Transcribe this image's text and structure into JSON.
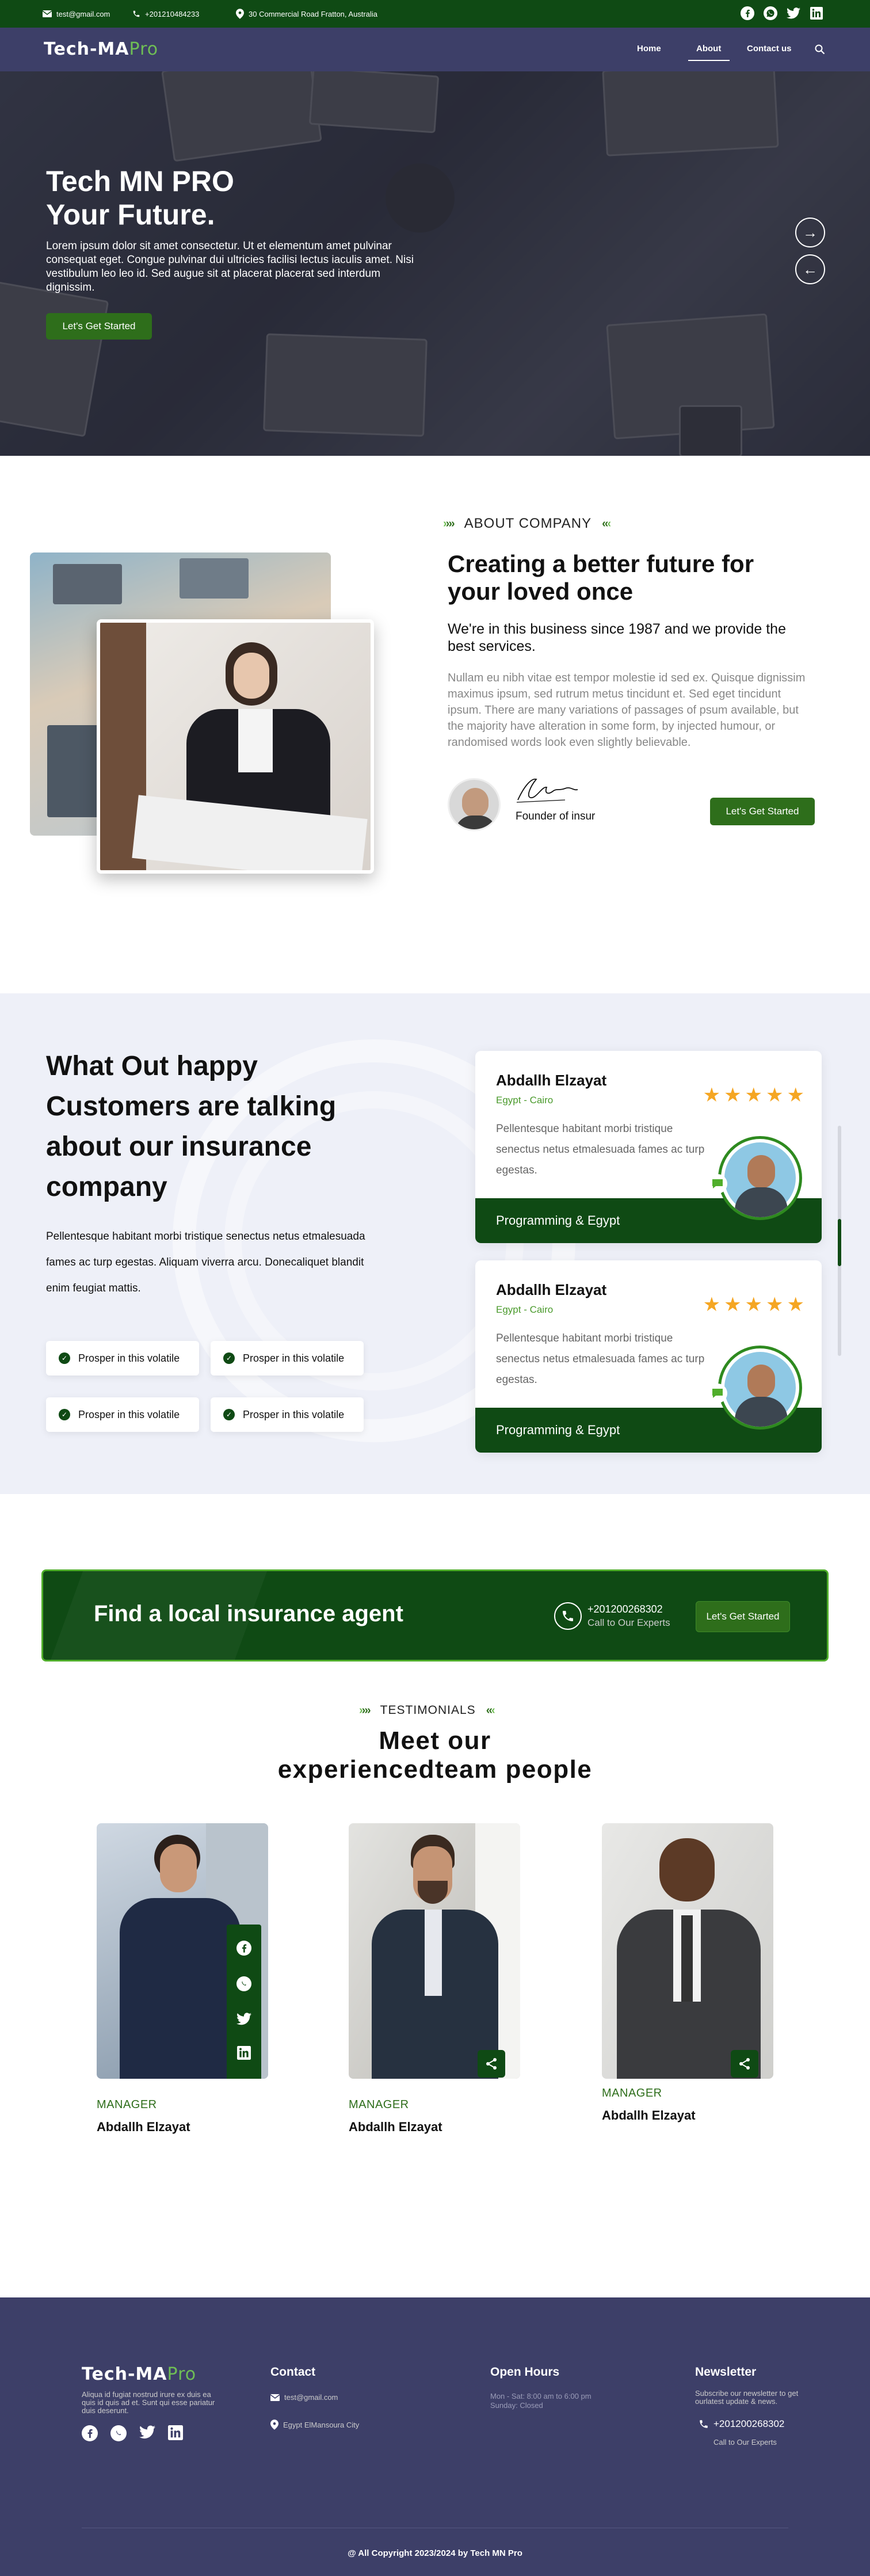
{
  "topbar": {
    "email": "test@gmail.com",
    "phone": "+201210484233",
    "address": "30 Commercial Road Fratton, Australia",
    "social_icons": [
      "facebook-icon",
      "whatsapp-icon",
      "twitter-icon",
      "linkedin-icon"
    ]
  },
  "nav": {
    "logo_main": "Tech-MA",
    "logo_pro": "Pro",
    "links": [
      "Home",
      "About",
      "Contact us"
    ],
    "active": "About"
  },
  "hero": {
    "title_line1": "Tech MN PRO",
    "title_line2": "Your Future.",
    "text": "Lorem ipsum dolor sit amet consectetur. Ut et elementum amet pulvinar consequat eget. Congue pulvinar dui ultricies facilisi lectus iaculis amet. Nisi vestibulum leo leo id. Sed augue sit at placerat placerat sed interdum dignissim.",
    "button": "Let's Get Started"
  },
  "about": {
    "tag": "ABOUT COMPANY",
    "title": "Creating a better future for your loved once",
    "subtitle": "We're in this business since 1987 and we provide the best services.",
    "text": "Nullam eu nibh vitae est tempor molestie id sed ex. Quisque dignissim maximus ipsum, sed rutrum metus tincidunt et. Sed eget tincidunt ipsum. There are many variations of passages of psum available, but the majority have alteration in some form, by injected humour, or randomised words look even slightly believable.",
    "founder_label": "Founder of insur",
    "button": "Let's Get Started"
  },
  "testimonials_block": {
    "heading": "What Out happy Customers are talking about our insurance company",
    "text": "Pellentesque habitant morbi tristique senectus netus etmalesuada fames ac turp egestas. Aliquam viverra arcu. Donecaliquet blandit enim feugiat mattis.",
    "features": [
      "Prosper in this volatile",
      "Prosper in this volatile",
      "Prosper in this volatile",
      "Prosper in this volatile"
    ],
    "cards": [
      {
        "name": "Abdallh Elzayat",
        "location": "Egypt - Cairo",
        "rating": 5,
        "text": "Pellentesque habitant morbi tristique senectus netus etmalesuada fames ac turp egestas.",
        "footer": "Programming & Egypt"
      },
      {
        "name": "Abdallh Elzayat",
        "location": "Egypt - Cairo",
        "rating": 5,
        "text": "Pellentesque habitant morbi tristique senectus netus etmalesuada fames ac turp egestas.",
        "footer": "Programming & Egypt"
      }
    ]
  },
  "cta": {
    "title": "Find a local insurance agent",
    "phone": "+201200268302",
    "phone_label": "Call to Our Experts",
    "button": "Let's Get Started"
  },
  "team": {
    "tag": "TESTIMONIALS",
    "title_line1": "Meet our",
    "title_line2": "experiencedteam people",
    "members": [
      {
        "role": "MANAGER",
        "name": "Abdallh Elzayat"
      },
      {
        "role": "MANAGER",
        "name": "Abdallh Elzayat"
      },
      {
        "role": "MANAGER",
        "name": "Abdallh Elzayat"
      }
    ]
  },
  "footer": {
    "logo_main": "Tech-MA",
    "logo_pro": "Pro",
    "about_text": "Aliqua id fugiat nostrud irure ex duis ea quis id quis ad et. Sunt qui esse pariatur duis deserunt.",
    "contact_title": "Contact",
    "contact_email": "test@gmail.com",
    "contact_address": "Egypt ElMansoura City",
    "hours_title": "Open Hours",
    "hours_line1": "Mon - Sat: 8:00 am to 6:00 pm",
    "hours_line2": "Sunday: Closed",
    "newsletter_title": "Newsletter",
    "newsletter_text": "Subscribe our newsletter to get ourlatest update & news.",
    "newsletter_phone": "+201200268302",
    "newsletter_phone_label": "Call to Our Experts",
    "copyright": "@ All Copyright 2023/2024 by Tech MN Pro"
  }
}
